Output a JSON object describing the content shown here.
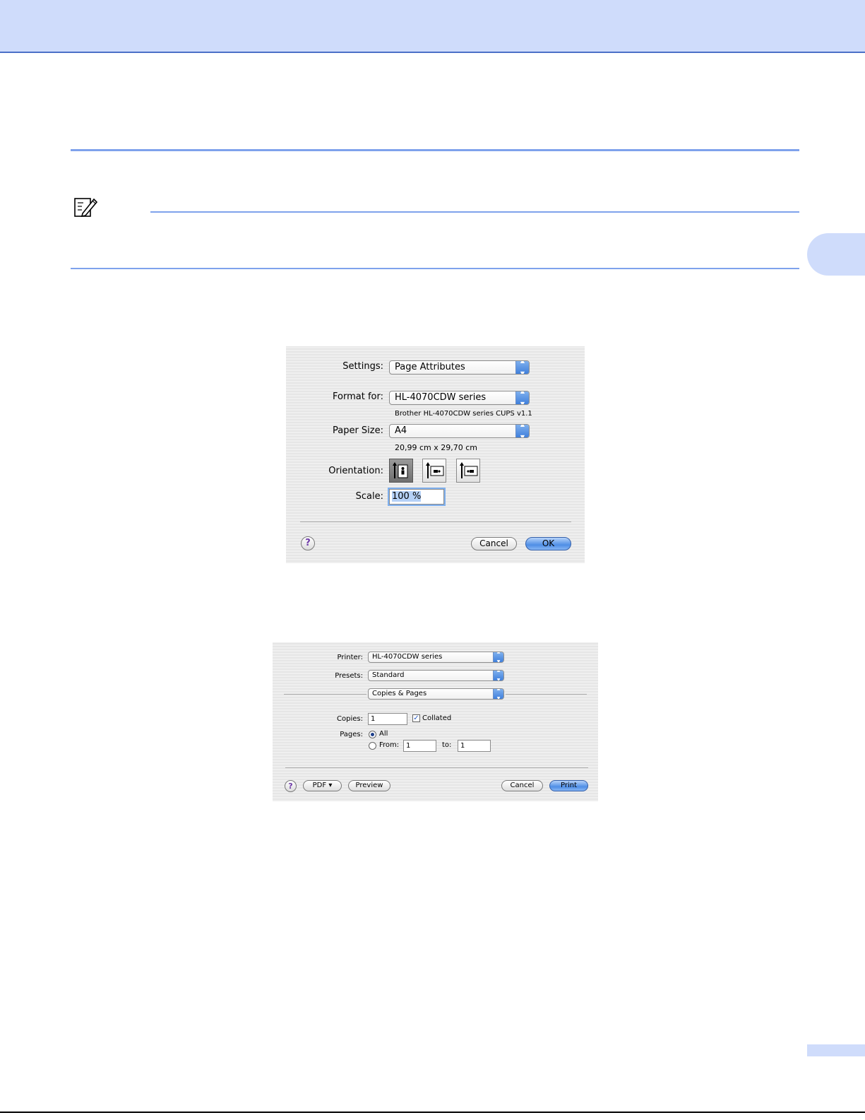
{
  "page_setup_dialog": {
    "settings_label": "Settings:",
    "settings_value": "Page Attributes",
    "format_for_label": "Format for:",
    "format_for_value": "HL-4070CDW series",
    "format_for_sub": "Brother HL-4070CDW series CUPS v1.1",
    "paper_size_label": "Paper Size:",
    "paper_size_value": "A4",
    "paper_size_sub": "20,99 cm x 29,70 cm",
    "orientation_label": "Orientation:",
    "orientation_options": [
      "portrait",
      "landscape-left",
      "landscape-right"
    ],
    "orientation_selected": "portrait",
    "scale_label": "Scale:",
    "scale_value": "100 %",
    "help_label": "?",
    "cancel_label": "Cancel",
    "ok_label": "OK"
  },
  "print_dialog": {
    "printer_label": "Printer:",
    "printer_value": "HL-4070CDW series",
    "presets_label": "Presets:",
    "presets_value": "Standard",
    "panel_value": "Copies & Pages",
    "copies_label": "Copies:",
    "copies_value": "1",
    "collated_label": "Collated",
    "collated_checked": true,
    "pages_label": "Pages:",
    "all_label": "All",
    "from_label": "From:",
    "from_value": "1",
    "to_label": "to:",
    "to_value": "1",
    "pages_selected": "All",
    "help_label": "?",
    "pdf_label": "PDF ▾",
    "preview_label": "Preview",
    "cancel_label": "Cancel",
    "print_label": "Print"
  },
  "colors": {
    "header_band": "#cfdcfb",
    "rule": "#7fa2ec",
    "accent_button": "#4f8ee6"
  }
}
